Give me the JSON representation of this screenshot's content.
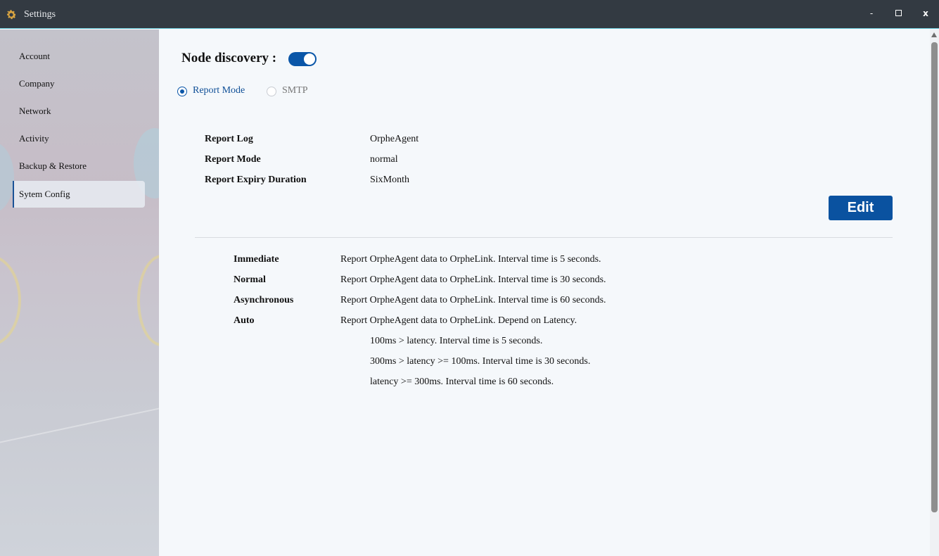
{
  "window": {
    "title": "Settings",
    "app_icon": "gear-icon",
    "controls": {
      "minimize": "-",
      "close": "x"
    }
  },
  "sidebar": {
    "items": [
      {
        "label": "Account"
      },
      {
        "label": "Company"
      },
      {
        "label": "Network"
      },
      {
        "label": "Activity"
      },
      {
        "label": "Backup & Restore"
      },
      {
        "label": "Sytem Config",
        "active": true
      }
    ]
  },
  "main": {
    "node_discovery_label": "Node discovery :",
    "node_discovery_enabled": true,
    "modes": [
      {
        "label": "Report Mode",
        "checked": true
      },
      {
        "label": "SMTP",
        "checked": false
      }
    ],
    "info": [
      {
        "key": "Report Log",
        "value": "OrpheAgent"
      },
      {
        "key": "Report Mode",
        "value": "normal"
      },
      {
        "key": "Report Expiry Duration",
        "value": "SixMonth"
      }
    ],
    "edit_label": "Edit",
    "descriptions": [
      {
        "key": "Immediate",
        "value": "Report OrpheAgent data to OrpheLink. Interval time is 5 seconds."
      },
      {
        "key": "Normal",
        "value": "Report OrpheAgent data to OrpheLink. Interval time is 30 seconds."
      },
      {
        "key": "Asynchronous",
        "value": "Report OrpheAgent data to OrpheLink. Interval time is 60 seconds."
      },
      {
        "key": "Auto",
        "value": "Report OrpheAgent data to OrpheLink. Depend on Latency."
      }
    ],
    "auto_details": [
      "100ms > latency. Interval time is 5 seconds.",
      "300ms > latency >= 100ms. Interval time is 30 seconds.",
      "latency >= 300ms. Interval time is 60 seconds."
    ]
  },
  "colors": {
    "accent": "#0a56a8",
    "titlebar": "#333a42",
    "app_icon": "#d9a441"
  }
}
